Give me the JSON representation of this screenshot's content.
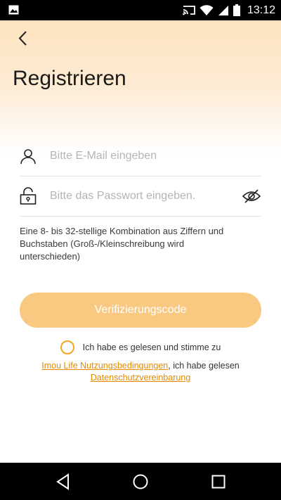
{
  "status_bar": {
    "time": "13:12",
    "icons": [
      "gallery-icon",
      "cast-icon",
      "wifi-icon",
      "signal-icon",
      "battery-icon"
    ]
  },
  "header": {
    "title": "Registrieren"
  },
  "form": {
    "email_placeholder": "Bitte E-Mail eingeben",
    "email_value": "",
    "password_placeholder": "Bitte das Passwort eingeben.",
    "password_value": "",
    "password_hint": "Eine 8- bis 32-stellige Kombination aus Ziffern und Buchstaben (Groß-/Kleinschreibung wird unterschieden)",
    "submit_label": "Verifizierungscode"
  },
  "agreement": {
    "checked": false,
    "text": "Ich habe es gelesen und stimme zu",
    "terms_link": "Imou Life Nutzungsbedingungen",
    "middle_text": ", ich habe gelesen",
    "privacy_link": "Datenschutzvereinbarung"
  },
  "colors": {
    "accent": "#f5a623",
    "button_disabled": "#f9c982",
    "link": "#e48b00",
    "header_gradient": "#fde3c0"
  },
  "nav_bar": {
    "buttons": [
      "back-triangle-icon",
      "home-circle-icon",
      "recents-square-icon"
    ]
  }
}
